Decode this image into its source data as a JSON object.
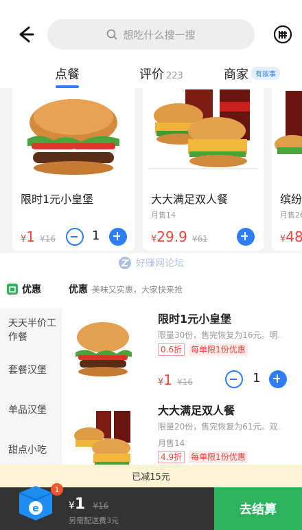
{
  "header": {
    "search_placeholder": "想吃什么搜一搜"
  },
  "tabs": [
    {
      "label": "点餐"
    },
    {
      "label": "评价",
      "count": "223"
    },
    {
      "label": "商家",
      "badge": "有故事"
    }
  ],
  "featured": [
    {
      "name": "限时1元小皇堡",
      "sold": "",
      "price": "1",
      "old": "¥16",
      "qty": "1"
    },
    {
      "name": "大大满足双人餐",
      "sold": "月售14",
      "price": "29.9",
      "old": "¥61"
    },
    {
      "name": "缤纷",
      "sold": "月售26",
      "price": "48"
    }
  ],
  "currency": "¥",
  "watermark": "好赚网论坛",
  "section": {
    "left_title": "优惠",
    "right_title": "优惠",
    "right_subtitle": "美味又实惠，大家快来抢"
  },
  "categories": [
    "天天半价工作餐",
    "套餐汉堡",
    "单品汉堡",
    "甜点小吃"
  ],
  "items": [
    {
      "title": "限时1元小皇堡",
      "desc": "限量30份，售完恢复为16元。明...",
      "discount": "0.6折",
      "limit": "每单限1份优惠",
      "price": "1",
      "old": "¥16",
      "qty": "1"
    },
    {
      "title": "大大满足双人餐",
      "desc": "限量20份，售完恢复为61元。双...",
      "sold": "月售14",
      "discount": "4.9折",
      "limit": "每单限1份优惠"
    }
  ],
  "cart": {
    "discount_text": "已减15元",
    "count": "1",
    "price": "1",
    "old": "¥16",
    "delivery": "另需配送费3元",
    "checkout": "去结算"
  },
  "colors": {
    "accent": "#2e7cf6",
    "price": "#e8453c",
    "checkout": "#2db35e",
    "cart_bar": "#333333",
    "discount_bar": "#fdf4d6"
  }
}
